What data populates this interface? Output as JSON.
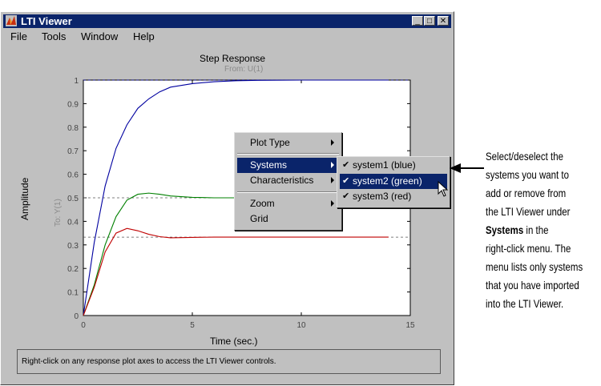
{
  "window": {
    "title": "LTI Viewer",
    "controls": {
      "minimize": "_",
      "maximize": "□",
      "close": "✕"
    }
  },
  "menubar": [
    "File",
    "Tools",
    "Window",
    "Help"
  ],
  "plot": {
    "title": "Step Response",
    "subtitle": "From: U(1)",
    "ylabel": "Amplitude",
    "channel_label": "To: Y(1)",
    "xlabel": "Time (sec.)"
  },
  "chart_data": {
    "type": "line",
    "title": "Step Response",
    "subtitle": "From: U(1)",
    "xlabel": "Time (sec.)",
    "ylabel": "Amplitude",
    "xlim": [
      0,
      15
    ],
    "ylim": [
      0,
      1
    ],
    "xticks": [
      "0",
      "5",
      "10",
      "15"
    ],
    "yticks": [
      "0",
      "0.1",
      "0.2",
      "0.3",
      "0.4",
      "0.5",
      "0.6",
      "0.7",
      "0.8",
      "0.9",
      "1"
    ],
    "grid": false,
    "series": [
      {
        "name": "system1 (blue)",
        "color": "#0000a0",
        "x": [
          0,
          0.5,
          1,
          1.5,
          2,
          2.5,
          3,
          3.5,
          4,
          5,
          6,
          7,
          8,
          10,
          12,
          14
        ],
        "y": [
          0,
          0.31,
          0.55,
          0.71,
          0.81,
          0.88,
          0.92,
          0.95,
          0.97,
          0.985,
          0.993,
          0.997,
          0.999,
          1,
          1,
          1
        ]
      },
      {
        "name": "system2 (green)",
        "color": "#008000",
        "x": [
          0,
          0.5,
          1,
          1.5,
          2,
          2.5,
          3,
          3.5,
          4,
          5,
          6,
          8,
          10,
          12,
          14
        ],
        "y": [
          0,
          0.13,
          0.3,
          0.42,
          0.49,
          0.515,
          0.52,
          0.515,
          0.508,
          0.502,
          0.5,
          0.5,
          0.5,
          0.5,
          0.5
        ]
      },
      {
        "name": "system3 (red)",
        "color": "#c00000",
        "x": [
          0,
          0.5,
          1,
          1.5,
          2,
          2.5,
          3,
          3.5,
          4,
          5,
          6,
          8,
          10,
          12,
          14
        ],
        "y": [
          0,
          0.12,
          0.27,
          0.35,
          0.37,
          0.36,
          0.345,
          0.335,
          0.33,
          0.332,
          0.333,
          0.333,
          0.333,
          0.333,
          0.333
        ]
      }
    ],
    "reference_lines": [
      0.5,
      0.333
    ]
  },
  "status": "Right-click on any response plot axes to access the LTI Viewer controls.",
  "context_menu": {
    "items": [
      "Plot Type",
      "Systems",
      "Characteristics",
      "Zoom",
      "Grid"
    ],
    "selected": "Systems"
  },
  "systems_submenu": [
    {
      "label": "system1 (blue)",
      "checked": true
    },
    {
      "label": "system2 (green)",
      "checked": true,
      "selected": true
    },
    {
      "label": "system3 (red)",
      "checked": true
    }
  ],
  "annotation": {
    "line1": "Select/deselect the",
    "line2": "systems you want to",
    "line3": "add or remove from",
    "line4": "the LTI Viewer under",
    "line5_bold": "Systems",
    "line5_rest": " in the",
    "line6": "right-click menu. The",
    "line7": "menu lists only systems",
    "line8": "that you have imported",
    "line9": "into the LTI Viewer."
  }
}
